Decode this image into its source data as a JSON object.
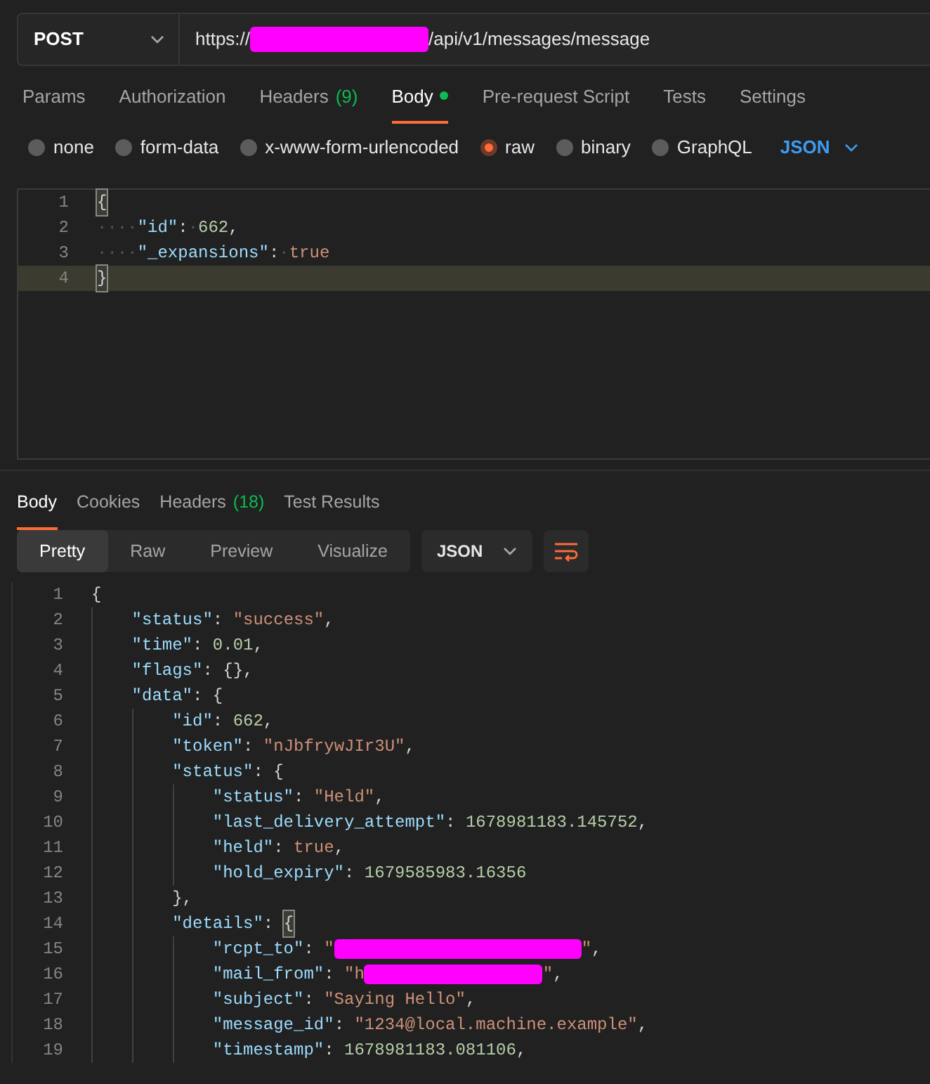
{
  "request": {
    "method": "POST",
    "url_parts": [
      {
        "kind": "text",
        "text": "https://"
      },
      {
        "kind": "redacted"
      },
      {
        "kind": "text",
        "text": "/api/v1/messages/message"
      }
    ]
  },
  "request_tabs": [
    {
      "label": "Params",
      "selected": false
    },
    {
      "label": "Authorization",
      "selected": false
    },
    {
      "label": "Headers",
      "count": "(9)",
      "selected": false
    },
    {
      "label": "Body",
      "dot": true,
      "selected": true
    },
    {
      "label": "Pre-request Script",
      "selected": false
    },
    {
      "label": "Tests",
      "selected": false
    },
    {
      "label": "Settings",
      "selected": false
    }
  ],
  "body_types": [
    {
      "label": "none",
      "selected": false
    },
    {
      "label": "form-data",
      "selected": false
    },
    {
      "label": "x-www-form-urlencoded",
      "selected": false
    },
    {
      "label": "raw",
      "selected": true
    },
    {
      "label": "binary",
      "selected": false
    },
    {
      "label": "GraphQL",
      "selected": false
    }
  ],
  "body_format": "JSON",
  "request_body": [
    {
      "number": "1",
      "current": false,
      "tokens": [
        {
          "kind": "bracket",
          "text": "{",
          "matched": true
        }
      ]
    },
    {
      "number": "2",
      "current": false,
      "tokens": [
        {
          "kind": "space",
          "text": "····"
        },
        {
          "kind": "key",
          "text": "\"id\""
        },
        {
          "kind": "punct",
          "text": ":"
        },
        {
          "kind": "space",
          "text": "·"
        },
        {
          "kind": "number",
          "text": "662"
        },
        {
          "kind": "punct",
          "text": ","
        }
      ]
    },
    {
      "number": "3",
      "current": false,
      "tokens": [
        {
          "kind": "space",
          "text": "····"
        },
        {
          "kind": "key",
          "text": "\"_expansions\""
        },
        {
          "kind": "punct",
          "text": ":"
        },
        {
          "kind": "space",
          "text": "·"
        },
        {
          "kind": "bool",
          "text": "true"
        }
      ]
    },
    {
      "number": "4",
      "current": true,
      "tokens": [
        {
          "kind": "bracket",
          "text": "}",
          "matched": true
        }
      ]
    }
  ],
  "response_tabs": [
    {
      "label": "Body",
      "selected": true
    },
    {
      "label": "Cookies",
      "selected": false
    },
    {
      "label": "Headers",
      "count": "(18)",
      "selected": false
    },
    {
      "label": "Test Results",
      "selected": false
    }
  ],
  "view_modes": [
    {
      "label": "Pretty",
      "selected": true
    },
    {
      "label": "Raw",
      "selected": false
    },
    {
      "label": "Preview",
      "selected": false
    },
    {
      "label": "Visualize",
      "selected": false
    }
  ],
  "response_format": "JSON",
  "response_body": [
    {
      "number": "1",
      "tokens": [
        {
          "kind": "bracket",
          "text": "{"
        }
      ],
      "children": [
        {
          "number": "2",
          "tokens": [
            {
              "kind": "key",
              "text": "\"status\""
            },
            {
              "kind": "punct",
              "text": ": "
            },
            {
              "kind": "string",
              "text": "\"success\""
            },
            {
              "kind": "punct",
              "text": ","
            }
          ]
        },
        {
          "number": "3",
          "tokens": [
            {
              "kind": "key",
              "text": "\"time\""
            },
            {
              "kind": "punct",
              "text": ": "
            },
            {
              "kind": "number",
              "text": "0.01"
            },
            {
              "kind": "punct",
              "text": ","
            }
          ]
        },
        {
          "number": "4",
          "tokens": [
            {
              "kind": "key",
              "text": "\"flags\""
            },
            {
              "kind": "punct",
              "text": ": "
            },
            {
              "kind": "bracket",
              "text": "{}"
            },
            {
              "kind": "punct",
              "text": ","
            }
          ]
        },
        {
          "number": "5",
          "tokens": [
            {
              "kind": "key",
              "text": "\"data\""
            },
            {
              "kind": "punct",
              "text": ": "
            },
            {
              "kind": "bracket",
              "text": "{"
            }
          ],
          "children": [
            {
              "number": "6",
              "tokens": [
                {
                  "kind": "key",
                  "text": "\"id\""
                },
                {
                  "kind": "punct",
                  "text": ": "
                },
                {
                  "kind": "number",
                  "text": "662"
                },
                {
                  "kind": "punct",
                  "text": ","
                }
              ]
            },
            {
              "number": "7",
              "tokens": [
                {
                  "kind": "key",
                  "text": "\"token\""
                },
                {
                  "kind": "punct",
                  "text": ": "
                },
                {
                  "kind": "string",
                  "text": "\"nJbfrywJIr3U\""
                },
                {
                  "kind": "punct",
                  "text": ","
                }
              ]
            },
            {
              "number": "8",
              "tokens": [
                {
                  "kind": "key",
                  "text": "\"status\""
                },
                {
                  "kind": "punct",
                  "text": ": "
                },
                {
                  "kind": "bracket",
                  "text": "{"
                }
              ],
              "children": [
                {
                  "number": "9",
                  "tokens": [
                    {
                      "kind": "key",
                      "text": "\"status\""
                    },
                    {
                      "kind": "punct",
                      "text": ": "
                    },
                    {
                      "kind": "string",
                      "text": "\"Held\""
                    },
                    {
                      "kind": "punct",
                      "text": ","
                    }
                  ]
                },
                {
                  "number": "10",
                  "tokens": [
                    {
                      "kind": "key",
                      "text": "\"last_delivery_attempt\""
                    },
                    {
                      "kind": "punct",
                      "text": ": "
                    },
                    {
                      "kind": "number",
                      "text": "1678981183.145752"
                    },
                    {
                      "kind": "punct",
                      "text": ","
                    }
                  ]
                },
                {
                  "number": "11",
                  "tokens": [
                    {
                      "kind": "key",
                      "text": "\"held\""
                    },
                    {
                      "kind": "punct",
                      "text": ": "
                    },
                    {
                      "kind": "bool",
                      "text": "true"
                    },
                    {
                      "kind": "punct",
                      "text": ","
                    }
                  ]
                },
                {
                  "number": "12",
                  "tokens": [
                    {
                      "kind": "key",
                      "text": "\"hold_expiry\""
                    },
                    {
                      "kind": "punct",
                      "text": ": "
                    },
                    {
                      "kind": "number",
                      "text": "1679585983.16356"
                    }
                  ]
                }
              ]
            },
            {
              "number": "13",
              "tokens": [
                {
                  "kind": "bracket",
                  "text": "}"
                },
                {
                  "kind": "punct",
                  "text": ","
                }
              ]
            },
            {
              "number": "14",
              "tokens": [
                {
                  "kind": "key",
                  "text": "\"details\""
                },
                {
                  "kind": "punct",
                  "text": ": "
                },
                {
                  "kind": "bracket",
                  "text": "{",
                  "matched": true
                }
              ],
              "children": [
                {
                  "number": "15",
                  "tokens": [
                    {
                      "kind": "key",
                      "text": "\"rcpt_to\""
                    },
                    {
                      "kind": "punct",
                      "text": ": "
                    },
                    {
                      "kind": "string",
                      "text": "\""
                    },
                    {
                      "kind": "redacted"
                    },
                    {
                      "kind": "string",
                      "text": "\""
                    },
                    {
                      "kind": "punct",
                      "text": ","
                    }
                  ]
                },
                {
                  "number": "16",
                  "tokens": [
                    {
                      "kind": "key",
                      "text": "\"mail_from\""
                    },
                    {
                      "kind": "punct",
                      "text": ": "
                    },
                    {
                      "kind": "string",
                      "text": "\"h"
                    },
                    {
                      "kind": "redacted"
                    },
                    {
                      "kind": "string",
                      "text": "\""
                    },
                    {
                      "kind": "punct",
                      "text": ","
                    }
                  ]
                },
                {
                  "number": "17",
                  "tokens": [
                    {
                      "kind": "key",
                      "text": "\"subject\""
                    },
                    {
                      "kind": "punct",
                      "text": ": "
                    },
                    {
                      "kind": "string",
                      "text": "\"Saying Hello\""
                    },
                    {
                      "kind": "punct",
                      "text": ","
                    }
                  ]
                },
                {
                  "number": "18",
                  "tokens": [
                    {
                      "kind": "key",
                      "text": "\"message_id\""
                    },
                    {
                      "kind": "punct",
                      "text": ": "
                    },
                    {
                      "kind": "string",
                      "text": "\"1234@local.machine.example\""
                    },
                    {
                      "kind": "punct",
                      "text": ","
                    }
                  ]
                },
                {
                  "number": "19",
                  "tokens": [
                    {
                      "kind": "key",
                      "text": "\"timestamp\""
                    },
                    {
                      "kind": "punct",
                      "text": ": "
                    },
                    {
                      "kind": "number",
                      "text": "1678981183.081106"
                    },
                    {
                      "kind": "punct",
                      "text": ","
                    }
                  ]
                }
              ]
            }
          ]
        }
      ]
    }
  ]
}
